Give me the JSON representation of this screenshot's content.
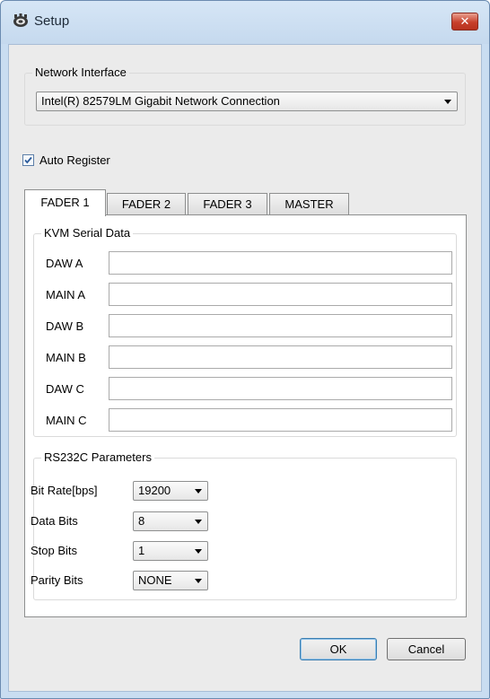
{
  "window": {
    "title": "Setup",
    "icon": "gear-icon",
    "close_glyph": "✕"
  },
  "network": {
    "legend": "Network Interface",
    "selected": "Intel(R) 82579LM Gigabit Network Connection"
  },
  "auto_register": {
    "label": "Auto Register",
    "checked": true
  },
  "tabs": [
    {
      "label": "FADER 1",
      "active": true
    },
    {
      "label": "FADER 2",
      "active": false
    },
    {
      "label": "FADER 3",
      "active": false
    },
    {
      "label": "MASTER",
      "active": false
    }
  ],
  "kvm": {
    "legend": "KVM Serial Data",
    "fields": [
      {
        "label": "DAW A",
        "value": ""
      },
      {
        "label": "MAIN A",
        "value": ""
      },
      {
        "label": "DAW B",
        "value": ""
      },
      {
        "label": "MAIN B",
        "value": ""
      },
      {
        "label": "DAW C",
        "value": ""
      },
      {
        "label": "MAIN C",
        "value": ""
      }
    ]
  },
  "rs232c": {
    "legend": "RS232C Parameters",
    "params": [
      {
        "label": "Bit Rate[bps]",
        "value": "19200"
      },
      {
        "label": "Data Bits",
        "value": "8"
      },
      {
        "label": "Stop Bits",
        "value": "1"
      },
      {
        "label": "Parity Bits",
        "value": "NONE"
      }
    ]
  },
  "buttons": {
    "ok": "OK",
    "cancel": "Cancel"
  },
  "colors": {
    "frame": "#c9ddf1",
    "client": "#ebebeb",
    "close": "#c7402b",
    "check": "#2a5a9a"
  }
}
